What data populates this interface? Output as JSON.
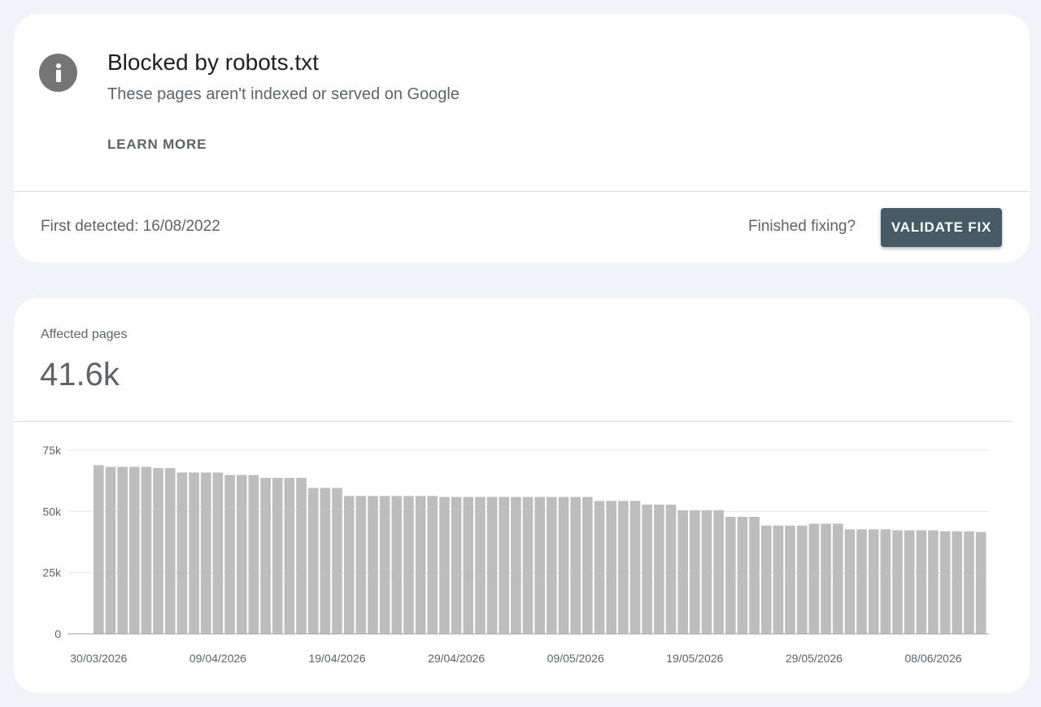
{
  "issue": {
    "icon": "info-icon",
    "title": "Blocked by robots.txt",
    "subtitle": "These pages aren't indexed or served on Google",
    "learn_more_label": "LEARN MORE",
    "first_detected": "First detected: 16/08/2022",
    "finished_fixing": "Finished fixing?",
    "validate_label": "VALIDATE FIX"
  },
  "summary": {
    "affected_label": "Affected pages",
    "affected_value": "41.6k"
  },
  "colors": {
    "bar": "#bdbdbd",
    "button": "#455a64",
    "icon": "#757575",
    "gridline": "#e8eaed",
    "axis": "#9e9e9e"
  },
  "chart_data": {
    "type": "bar",
    "categories": [
      "30/03/2026",
      "31/03/2026",
      "01/04/2026",
      "02/04/2026",
      "03/04/2026",
      "04/04/2026",
      "05/04/2026",
      "06/04/2026",
      "07/04/2026",
      "08/04/2026",
      "09/04/2026",
      "10/04/2026",
      "11/04/2026",
      "12/04/2026",
      "13/04/2026",
      "14/04/2026",
      "15/04/2026",
      "16/04/2026",
      "17/04/2026",
      "18/04/2026",
      "19/04/2026",
      "20/04/2026",
      "21/04/2026",
      "22/04/2026",
      "23/04/2026",
      "24/04/2026",
      "25/04/2026",
      "26/04/2026",
      "27/04/2026",
      "28/04/2026",
      "29/04/2026",
      "30/04/2026",
      "01/05/2026",
      "02/05/2026",
      "03/05/2026",
      "04/05/2026",
      "05/05/2026",
      "06/05/2026",
      "07/05/2026",
      "08/05/2026",
      "09/05/2026",
      "10/05/2026",
      "11/05/2026",
      "12/05/2026",
      "13/05/2026",
      "14/05/2026",
      "15/05/2026",
      "16/05/2026",
      "17/05/2026",
      "18/05/2026",
      "19/05/2026",
      "20/05/2026",
      "21/05/2026",
      "22/05/2026",
      "23/05/2026",
      "24/05/2026",
      "25/05/2026",
      "26/05/2026",
      "27/05/2026",
      "28/05/2026",
      "29/05/2026",
      "30/05/2026",
      "31/05/2026",
      "01/06/2026",
      "02/06/2026",
      "03/06/2026",
      "04/06/2026",
      "05/06/2026",
      "06/06/2026",
      "07/06/2026",
      "08/06/2026",
      "09/06/2026",
      "10/06/2026",
      "11/06/2026"
    ],
    "values": [
      68900,
      68200,
      68200,
      68200,
      68200,
      67700,
      67700,
      65900,
      65900,
      65900,
      65900,
      64900,
      64900,
      64900,
      63700,
      63700,
      63700,
      63700,
      59600,
      59600,
      59600,
      56300,
      56300,
      56300,
      56300,
      56300,
      56300,
      56300,
      56300,
      55900,
      55900,
      55900,
      55900,
      55900,
      55900,
      55900,
      55900,
      55900,
      55900,
      55900,
      55900,
      55900,
      54300,
      54300,
      54300,
      54300,
      52800,
      52800,
      52800,
      50500,
      50500,
      50500,
      50500,
      47800,
      47800,
      47800,
      44200,
      44200,
      44200,
      44200,
      45000,
      45000,
      45000,
      42700,
      42700,
      42700,
      42700,
      42300,
      42300,
      42300,
      42300,
      41900,
      41900,
      41900,
      41600
    ],
    "x_tick_labels": [
      "30/03/2026",
      "09/04/2026",
      "19/04/2026",
      "29/04/2026",
      "09/05/2026",
      "19/05/2026",
      "29/05/2026",
      "08/06/2026"
    ],
    "x_tick_indices": [
      0,
      10,
      20,
      30,
      40,
      50,
      60,
      70
    ],
    "y_ticks": [
      0,
      25000,
      50000,
      75000
    ],
    "y_tick_labels": [
      "0",
      "25k",
      "50k",
      "75k"
    ],
    "ylim": [
      0,
      75000
    ],
    "grid": true,
    "legend": "none"
  }
}
